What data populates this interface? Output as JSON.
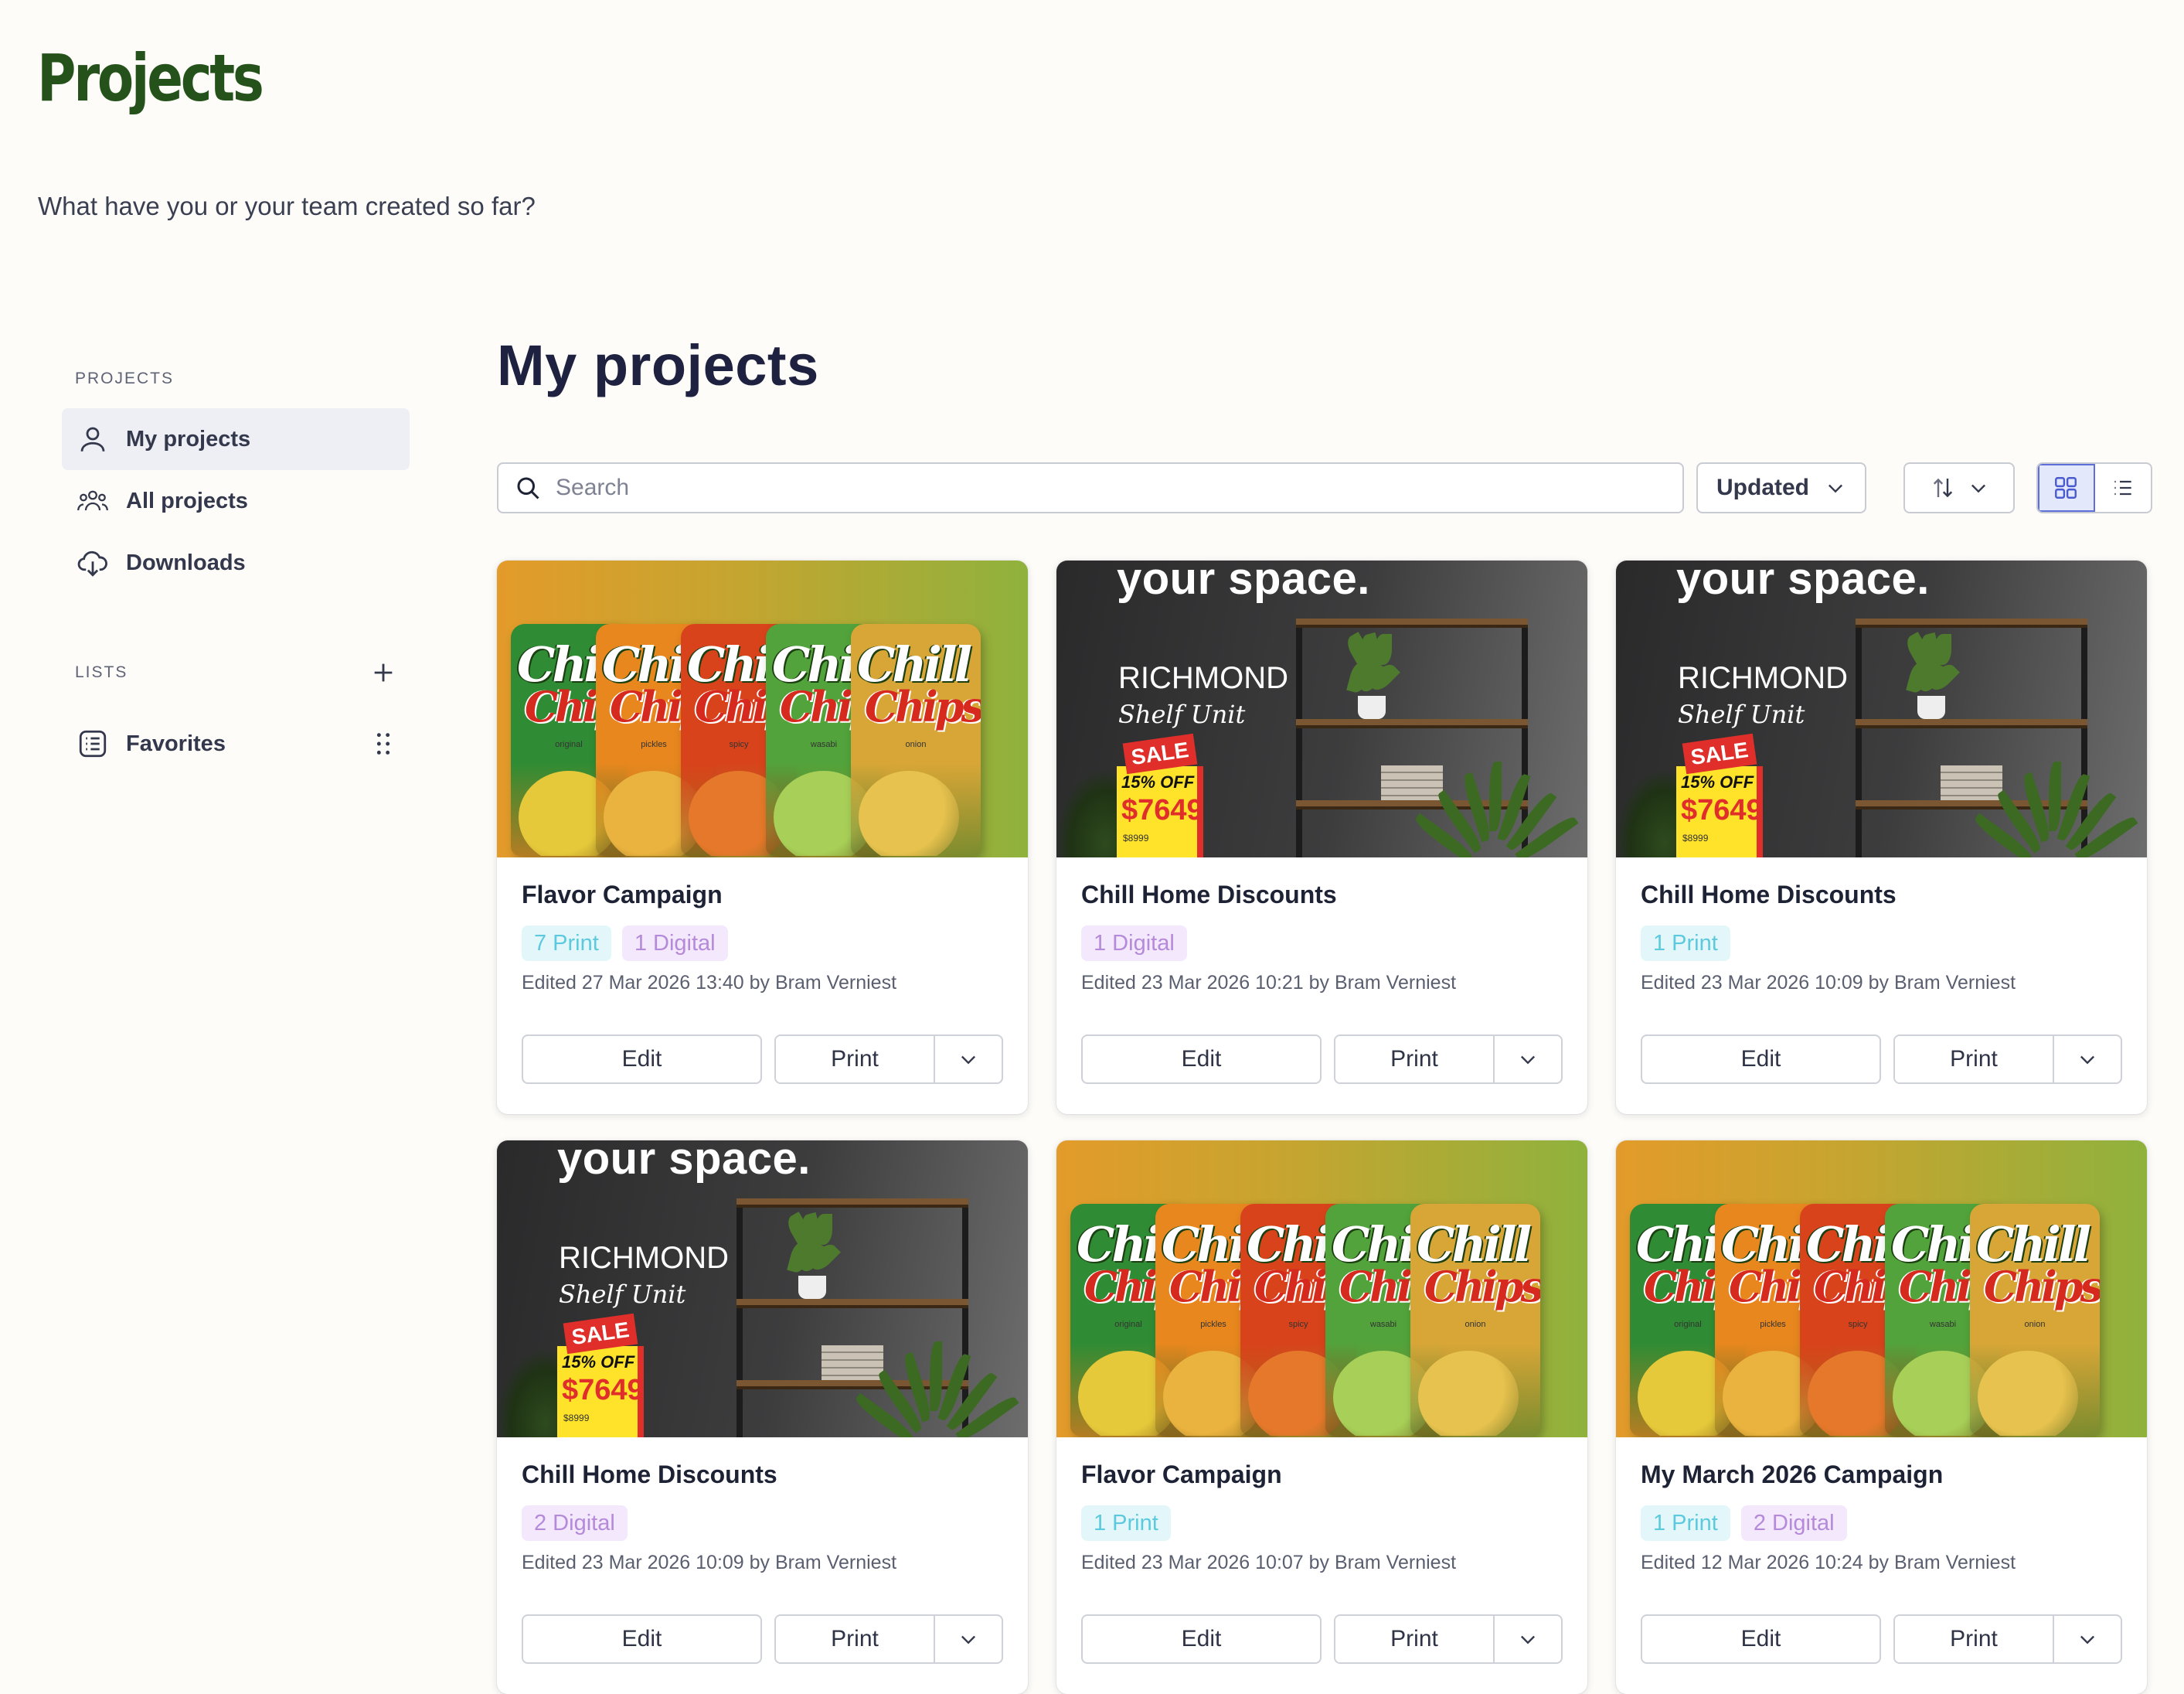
{
  "header": {
    "title": "Projects",
    "subtitle": "What have you or your team created so far?"
  },
  "sidebar": {
    "projects_heading": "PROJECTS",
    "items": [
      {
        "label": "My projects",
        "icon": "user-icon",
        "active": true
      },
      {
        "label": "All projects",
        "icon": "users-icon",
        "active": false
      },
      {
        "label": "Downloads",
        "icon": "cloud-download-icon",
        "active": false
      }
    ],
    "lists_heading": "LISTS",
    "lists": [
      {
        "label": "Favorites",
        "icon": "list-icon"
      }
    ]
  },
  "main": {
    "title": "My projects",
    "search": {
      "placeholder": "Search",
      "value": ""
    },
    "sort": {
      "selected": "Updated"
    },
    "view": {
      "active": "grid"
    }
  },
  "thumbnails": {
    "chips": {
      "brand_top": "Chill",
      "brand_bottom": "Chips",
      "flavors": [
        "original",
        "pickles",
        "spicy",
        "wasabi",
        "onion"
      ]
    },
    "shelf": {
      "headline": "your space.",
      "name": "RICHMOND",
      "sub": "Shelf Unit",
      "sale": "SALE",
      "off": "15% OFF",
      "price": "$7649",
      "was": "$8999"
    }
  },
  "cards": [
    {
      "title": "Flavor Campaign",
      "thumb": "chips",
      "badges": [
        {
          "type": "print",
          "label": "7 Print"
        },
        {
          "type": "digital",
          "label": "1 Digital"
        }
      ],
      "edited": "Edited 27 Mar 2026 13:40 by Bram Verniest",
      "edit_label": "Edit",
      "print_label": "Print"
    },
    {
      "title": "Chill Home Discounts",
      "thumb": "shelf",
      "badges": [
        {
          "type": "digital",
          "label": "1 Digital"
        }
      ],
      "edited": "Edited 23 Mar 2026 10:21 by Bram Verniest",
      "edit_label": "Edit",
      "print_label": "Print"
    },
    {
      "title": "Chill Home Discounts",
      "thumb": "shelf",
      "badges": [
        {
          "type": "print",
          "label": "1 Print"
        }
      ],
      "edited": "Edited 23 Mar 2026 10:09 by Bram Verniest",
      "edit_label": "Edit",
      "print_label": "Print"
    },
    {
      "title": "Chill Home Discounts",
      "thumb": "shelf",
      "badges": [
        {
          "type": "digital",
          "label": "2 Digital"
        }
      ],
      "edited": "Edited 23 Mar 2026 10:09 by Bram Verniest",
      "edit_label": "Edit",
      "print_label": "Print"
    },
    {
      "title": "Flavor Campaign",
      "thumb": "chips",
      "badges": [
        {
          "type": "print",
          "label": "1 Print"
        }
      ],
      "edited": "Edited 23 Mar 2026 10:07 by Bram Verniest",
      "edit_label": "Edit",
      "print_label": "Print"
    },
    {
      "title": "My March 2026 Campaign",
      "thumb": "chips",
      "badges": [
        {
          "type": "print",
          "label": "1 Print"
        },
        {
          "type": "digital",
          "label": "2 Digital"
        }
      ],
      "edited": "Edited 12 Mar 2026 10:24 by Bram Verniest",
      "edit_label": "Edit",
      "print_label": "Print"
    }
  ],
  "colors": {
    "title_green": "#24521a",
    "print_badge": "#5cc9dd",
    "digital_badge": "#b48ad9",
    "active_view": "#5f6fd9"
  }
}
